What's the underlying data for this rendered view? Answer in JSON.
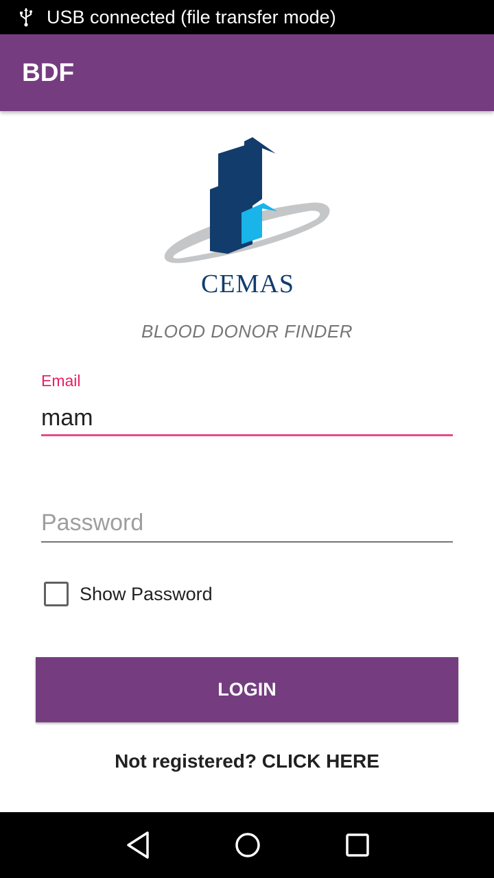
{
  "status_bar": {
    "icon": "usb-icon",
    "text": "USB connected (file transfer mode)"
  },
  "app_bar": {
    "title": "BDF"
  },
  "logo": {
    "text": "CEMAS",
    "colors": {
      "dark_blue": "#123c6c",
      "light_blue": "#18b4ea",
      "swoosh_gray": "#c4c6c8"
    }
  },
  "subtitle": "BLOOD DONOR FINDER",
  "form": {
    "email_label": "Email",
    "email_value": "mam",
    "password_placeholder": "Password",
    "password_value": "",
    "show_password_label": "Show Password",
    "show_password_checked": false,
    "login_label": "LOGIN",
    "register_text": "Not registered? CLICK HERE"
  },
  "nav_bar": {
    "back_icon": "back-triangle-icon",
    "home_icon": "home-circle-icon",
    "recents_icon": "recents-square-icon"
  },
  "colors": {
    "primary": "#753d80",
    "accent": "#e91e63"
  }
}
